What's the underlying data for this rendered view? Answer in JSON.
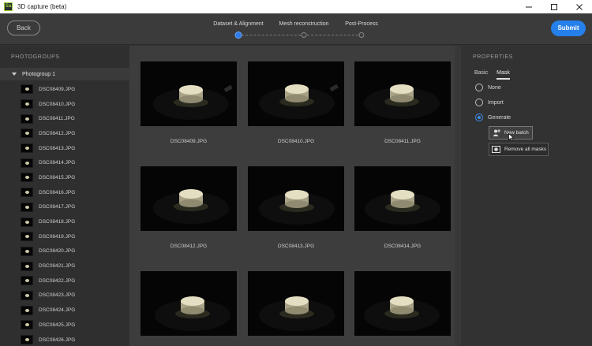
{
  "titlebar": {
    "title": "3D capture (beta)",
    "app_icon_text": "Sa"
  },
  "header": {
    "back_label": "Back",
    "submit_label": "Submit",
    "steps": [
      {
        "label": "Dataset & Alignment",
        "active": true
      },
      {
        "label": "Mesh reconstruction",
        "active": false
      },
      {
        "label": "Post-Process",
        "active": false
      }
    ]
  },
  "photogroups": {
    "title": "PHOTOGROUPS",
    "group_label": "Photogroup 1",
    "files": [
      "DSC08409.JPG",
      "DSC08410.JPG",
      "DSC08411.JPG",
      "DSC08412.JPG",
      "DSC08413.JPG",
      "DSC08414.JPG",
      "DSC08415.JPG",
      "DSC08416.JPG",
      "DSC08417.JPG",
      "DSC08418.JPG",
      "DSC08419.JPG",
      "DSC08420.JPG",
      "DSC08421.JPG",
      "DSC08422.JPG",
      "DSC08423.JPG",
      "DSC08424.JPG",
      "DSC08425.JPG",
      "DSC08426.JPG"
    ]
  },
  "gallery": {
    "items": [
      "DSC08409.JPG",
      "DSC08410.JPG",
      "DSC08411.JPG",
      "DSC08412.JPG",
      "DSC08413.JPG",
      "DSC08414.JPG",
      "",
      "",
      ""
    ]
  },
  "properties": {
    "title": "PROPERTIES",
    "tabs": [
      {
        "label": "Basic",
        "active": false
      },
      {
        "label": "Mask",
        "active": true
      }
    ],
    "mask_options": [
      {
        "label": "None",
        "checked": false
      },
      {
        "label": "Import",
        "checked": false
      },
      {
        "label": "Generate",
        "checked": true
      }
    ],
    "new_batch_label": "New batch",
    "remove_all_label": "Remove all masks"
  },
  "colors": {
    "accent": "#2680eb",
    "background": "#323232",
    "gallery_bg": "#3d3d3d"
  }
}
